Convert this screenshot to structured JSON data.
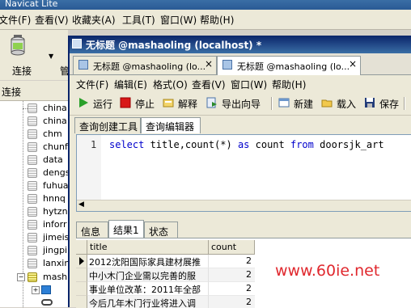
{
  "app": {
    "title": "Navicat Lite"
  },
  "outer_menu": [
    "文件(F)",
    "查看(V)",
    "收藏夹(A)",
    "工具(T)",
    "窗口(W)",
    "帮助(H)"
  ],
  "outer_toolbar": {
    "connect_label": "连接",
    "next_label": "管"
  },
  "tree": {
    "header": "连接",
    "items": [
      "china",
      "china",
      "chm",
      "chunf",
      "data",
      "dengs",
      "fuhua",
      "hnnq",
      "hytzn",
      "inforr",
      "jimeis",
      "jingpi",
      "lanxin",
      "mash"
    ]
  },
  "inner_window": {
    "title": "无标题 @mashaoling (localhost) *",
    "doc_tabs": [
      {
        "label": "无标题 @mashaoling (lo...",
        "close": "×"
      },
      {
        "label": "无标题 @mashaoling (lo...",
        "close": "×"
      }
    ],
    "menu": [
      "文件(F)",
      "编辑(E)",
      "格式(O)",
      "查看(V)",
      "窗口(W)",
      "帮助(H)"
    ],
    "toolbar": {
      "run": "运行",
      "stop": "停止",
      "explain": "解释",
      "export": "导出向导",
      "new": "新建",
      "load": "载入",
      "save": "保存"
    },
    "sub_tabs": [
      "查询创建工具",
      "查询编辑器"
    ],
    "editor": {
      "line_number": "1",
      "kw_select": "select",
      "expr": " title,count(*) ",
      "kw_as": "as",
      "alias": " count ",
      "kw_from": "from",
      "table": " doorsjk_art"
    },
    "result_tabs": [
      "信息",
      "结果1",
      "状态"
    ],
    "grid": {
      "columns": [
        "title",
        "count"
      ],
      "rows": [
        {
          "title": "2012沈阳国际家具建材展推",
          "count": "2"
        },
        {
          "title": "中小木门企业需以完善的服",
          "count": "2"
        },
        {
          "title": "事业单位改革：2011年全部",
          "count": "2"
        },
        {
          "title": "今后几年木门行业将进入调",
          "count": "2"
        }
      ]
    }
  },
  "watermark": "www.60ie.net"
}
